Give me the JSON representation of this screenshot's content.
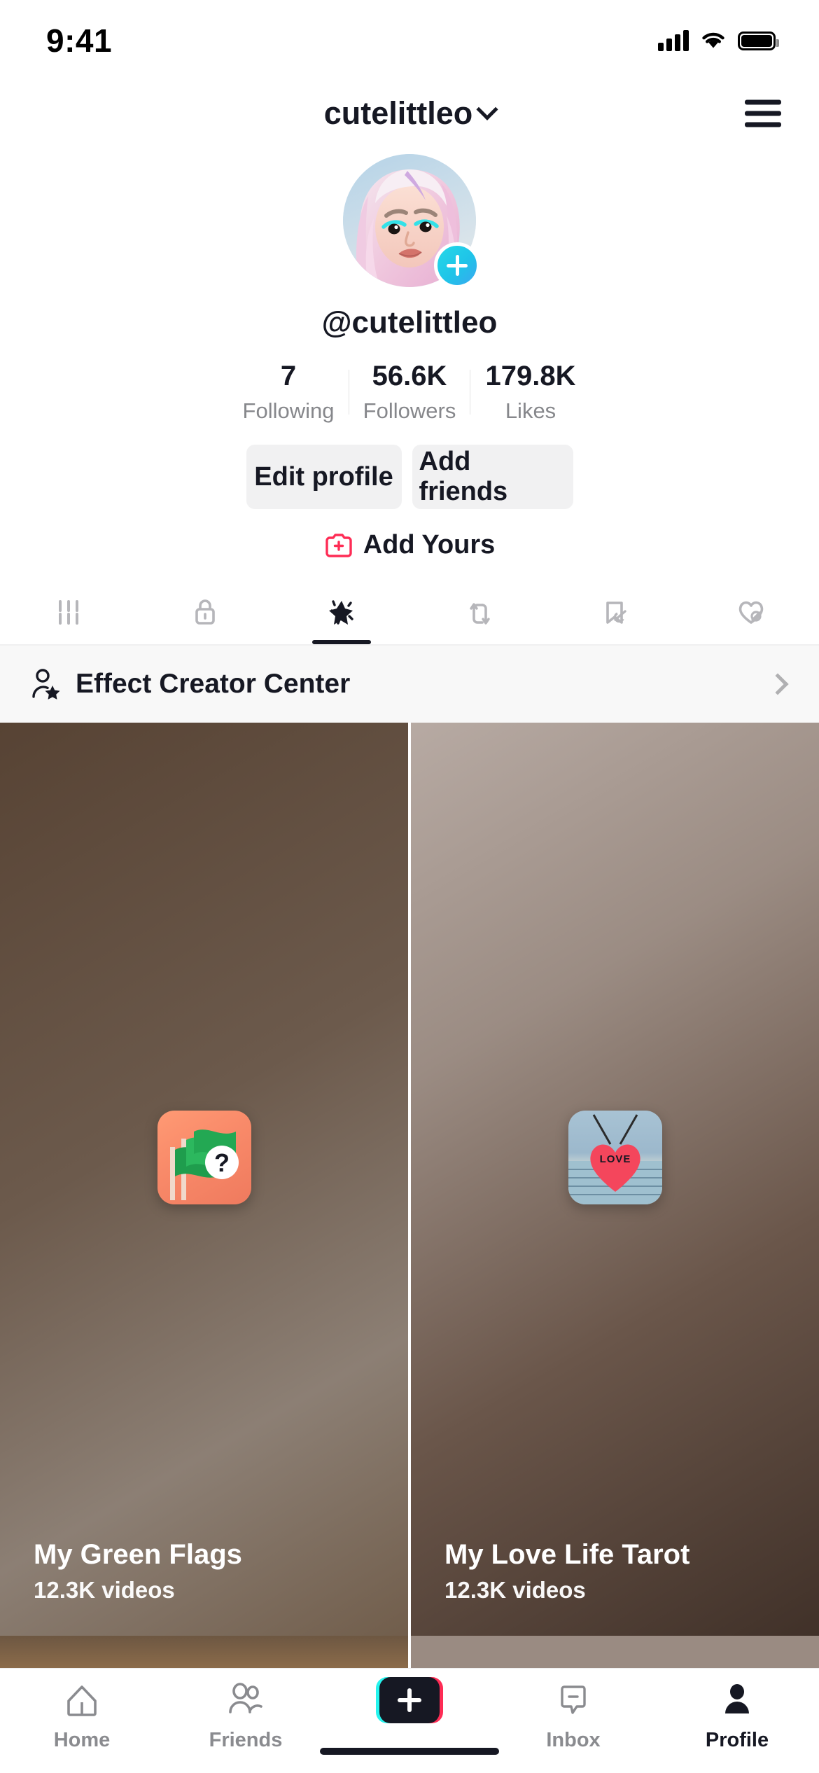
{
  "status_bar": {
    "time": "9:41",
    "cellular_icon": "signal-bars-icon",
    "wifi_icon": "wifi-icon",
    "battery_icon": "battery-full-icon"
  },
  "header": {
    "title": "cutelittleo",
    "dropdown_icon": "chevron-down-icon",
    "menu_icon": "hamburger-menu-icon"
  },
  "profile": {
    "avatar_alt": "avatar-memoji",
    "add_badge_icon": "plus-badge-icon",
    "handle": "@cutelittleo",
    "stats": [
      {
        "value": "7",
        "label": "Following"
      },
      {
        "value": "56.6K",
        "label": "Followers"
      },
      {
        "value": "179.8K",
        "label": "Likes"
      }
    ],
    "edit_profile_label": "Edit profile",
    "add_friends_label": "Add friends",
    "add_yours_label": "Add Yours",
    "add_yours_icon": "camera-plus-icon"
  },
  "tabs": [
    {
      "name": "posts",
      "icon": "grid-icon",
      "active": false
    },
    {
      "name": "private",
      "icon": "lock-icon",
      "active": false
    },
    {
      "name": "effects",
      "icon": "sparkle-star-icon",
      "active": true
    },
    {
      "name": "reposts",
      "icon": "repost-arrows-icon",
      "active": false
    },
    {
      "name": "saved",
      "icon": "bookmark-hidden-icon",
      "active": false
    },
    {
      "name": "liked",
      "icon": "heart-hidden-icon",
      "active": false
    }
  ],
  "effect_creator_center": {
    "label": "Effect Creator Center",
    "leading_icon": "person-star-icon",
    "chevron_icon": "chevron-right-icon"
  },
  "effects": [
    {
      "title": "My Green Flags",
      "videos": "12.3K videos",
      "thumb": "green-flags-thumb"
    },
    {
      "title": "My Love Life Tarot",
      "videos": "12.3K videos",
      "thumb": "love-tarot-thumb"
    }
  ],
  "bottom_nav": [
    {
      "label": "Home",
      "icon": "home-icon",
      "active": false
    },
    {
      "label": "Friends",
      "icon": "friends-icon",
      "active": false
    },
    {
      "label": "",
      "icon": "create-plus-icon",
      "active": false
    },
    {
      "label": "Inbox",
      "icon": "inbox-icon",
      "active": false
    },
    {
      "label": "Profile",
      "icon": "profile-person-icon",
      "active": true
    }
  ],
  "colors": {
    "accent_red": "#FE2C55",
    "accent_cyan": "#25F4EE",
    "text_primary": "#161823",
    "text_secondary": "#86878B",
    "button_bg": "#F1F1F2"
  }
}
